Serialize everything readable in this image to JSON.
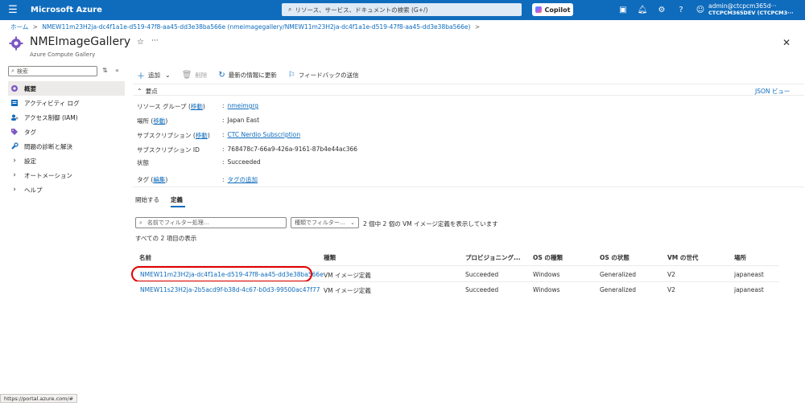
{
  "topbar": {
    "brand": "Microsoft Azure",
    "search_placeholder": "リソース、サービス、ドキュメントの検索 (G+/)",
    "copilot_label": "Copilot",
    "account_email": "admin@ctcpcm365d···",
    "account_org": "CTCPCM365DEV (CTCPCM3···"
  },
  "breadcrumb": {
    "home": "ホーム",
    "current": "NMEW11m23H2ja-dc4f1a1e-d519-47f8-aa45-dd3e38ba566e (nmeimagegallery/NMEW11m23H2ja-dc4f1a1e-d519-47f8-aa45-dd3e38ba566e)"
  },
  "header": {
    "title": "NMEImageGallery",
    "subtitle": "Azure Compute Gallery"
  },
  "sidebar": {
    "search_placeholder": "検索",
    "items": [
      {
        "label": "概要",
        "icon": "gallery-icon"
      },
      {
        "label": "アクティビティ ログ",
        "icon": "activity-log-icon"
      },
      {
        "label": "アクセス制御 (IAM)",
        "icon": "iam-icon"
      },
      {
        "label": "タグ",
        "icon": "tag-icon"
      },
      {
        "label": "問題の診断と解決",
        "icon": "wrench-icon"
      },
      {
        "label": "設定",
        "icon": "chevron-right-icon"
      },
      {
        "label": "オートメーション",
        "icon": "chevron-right-icon"
      },
      {
        "label": "ヘルプ",
        "icon": "chevron-right-icon"
      }
    ]
  },
  "commandbar": {
    "add": "追加",
    "delete": "削除",
    "refresh": "最新の情報に更新",
    "feedback": "フィードバックの送信"
  },
  "essentials": {
    "header": "要点",
    "json_view": "JSON ビュー",
    "resource_group_label": "リソース グループ",
    "move_link": "移動",
    "resource_group_value": "nmeimgrg",
    "location_label": "場所",
    "location_value": "Japan East",
    "subscription_label": "サブスクリプション",
    "subscription_value": "CTC Nerdio Subscription",
    "subscription_id_label": "サブスクリプション ID",
    "subscription_id_value": "768478c7-66a9-426a-9161-87b4e44ac366",
    "status_label": "状態",
    "status_value": "Succeeded",
    "tags_label": "タグ",
    "tags_edit_link": "編集",
    "tags_add_link": "タグの追加"
  },
  "tabs": {
    "get_started": "開始する",
    "definitions": "定義"
  },
  "filter": {
    "name_placeholder": "名前でフィルター処理...",
    "type_placeholder": "種類でフィルター...",
    "count_text": "2 個中 2 個の VM イメージ定義を表示しています",
    "showing_text": "すべての 2 項目の表示"
  },
  "table": {
    "headers": [
      "名前",
      "種類",
      "プロビジョニング...",
      "OS の種類",
      "OS の状態",
      "VM の世代",
      "場所"
    ],
    "rows": [
      [
        "NMEW11m23H2ja-dc4f1a1e-d519-47f8-aa45-dd3e38ba566e",
        "VM イメージ定義",
        "Succeeded",
        "Windows",
        "Generalized",
        "V2",
        "japaneast"
      ],
      [
        "NMEW11s23H2ja-2b5acd9f-b38d-4c67-b0d3-99500ac47f77",
        "VM イメージ定義",
        "Succeeded",
        "Windows",
        "Generalized",
        "V2",
        "japaneast"
      ]
    ]
  },
  "statusbar": {
    "url": "https://portal.azure.com/#"
  }
}
